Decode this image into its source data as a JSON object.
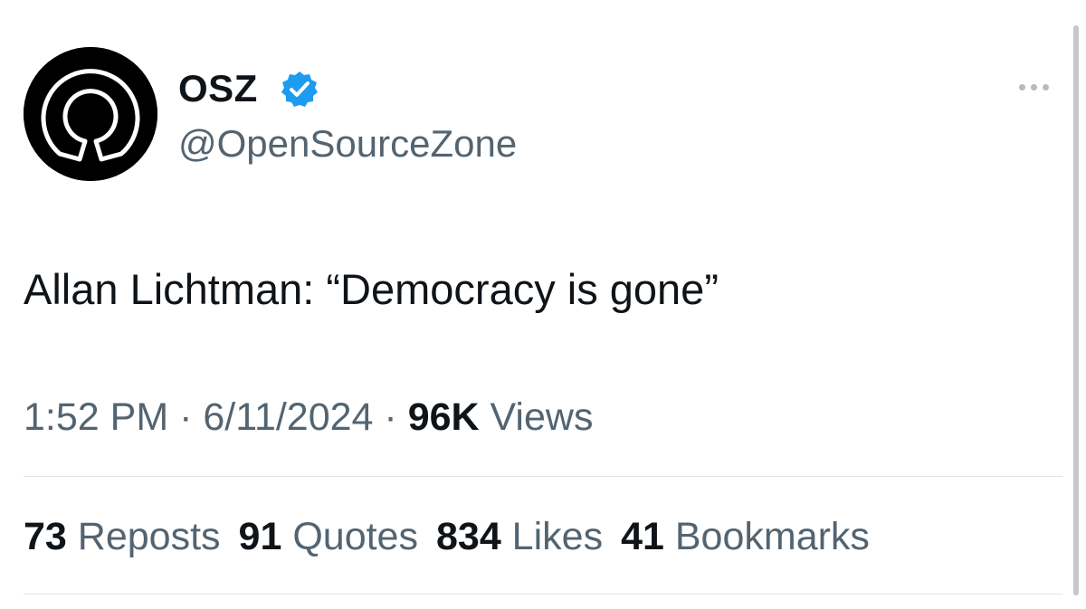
{
  "author": {
    "display_name": "OSZ",
    "handle": "@OpenSourceZone",
    "verified": true,
    "avatar_icon": "open-source-keyhole-logo",
    "verified_icon": "verified-badge-icon",
    "more_icon": "more-options-icon"
  },
  "tweet": {
    "text": "Allan Lichtman: “Democracy is gone”"
  },
  "meta": {
    "time": "1:52 PM",
    "separator": " · ",
    "date": "6/11/2024",
    "views_count": "96K",
    "views_label": " Views"
  },
  "stats": [
    {
      "count": "73",
      "label": " Reposts"
    },
    {
      "count": "91",
      "label": " Quotes"
    },
    {
      "count": "834",
      "label": " Likes"
    },
    {
      "count": "41",
      "label": " Bookmarks"
    }
  ],
  "colors": {
    "text_primary": "#0f1419",
    "text_secondary": "#536471",
    "verified_blue": "#1d9bf0",
    "divider": "#e1e6ea"
  }
}
